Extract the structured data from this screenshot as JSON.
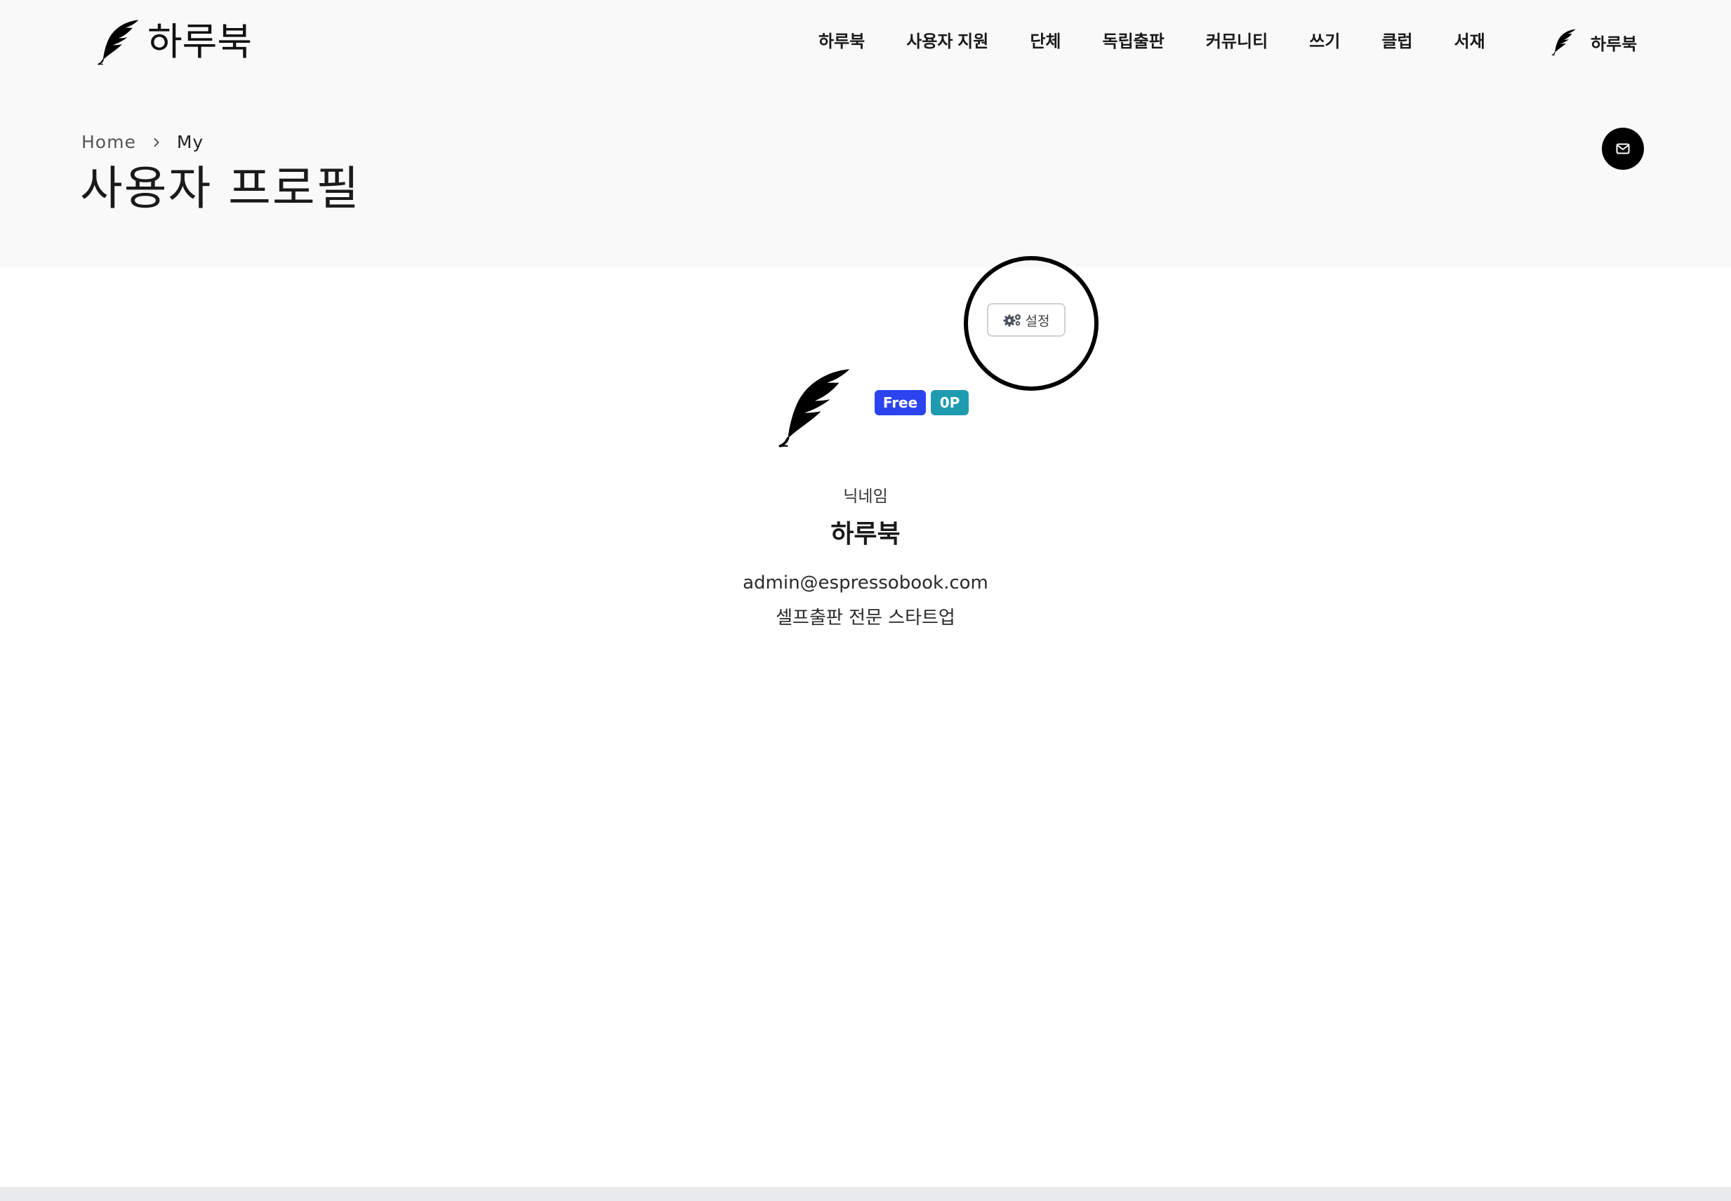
{
  "header": {
    "logo_text": "하루북",
    "nav": [
      "하루북",
      "사용자 지원",
      "단체",
      "독립출판",
      "커뮤니티",
      "쓰기",
      "클럽",
      "서재"
    ],
    "user_name": "하루북"
  },
  "breadcrumb": {
    "home": "Home",
    "current": "My"
  },
  "page_title": "사용자 프로필",
  "settings_label": "설정",
  "profile": {
    "plan_badge": "Free",
    "points_badge": "0P",
    "nickname_label": "닉네임",
    "nickname": "하루북",
    "email": "admin@espressobook.com",
    "bio": "셀프출판 전문 스타트업"
  },
  "colors": {
    "plan_badge": "#2b44f0",
    "points_badge": "#1f9bb0",
    "accent": "#000000"
  },
  "icons": [
    "feather-icon",
    "chevron-right-icon",
    "mail-icon",
    "gears-icon"
  ]
}
